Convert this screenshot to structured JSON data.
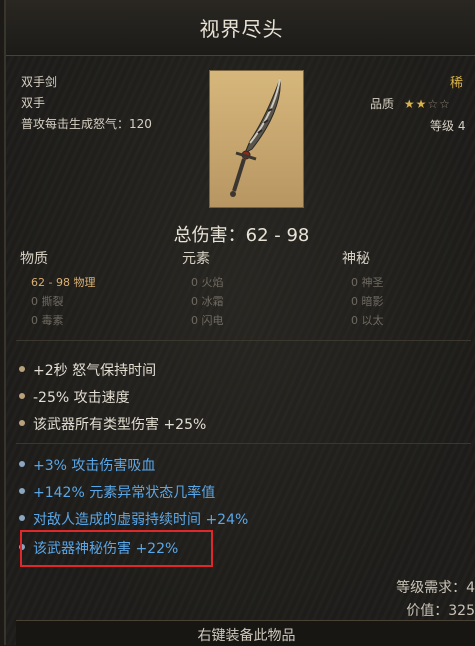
{
  "item": {
    "name": "视界尽头",
    "type": "双手剑",
    "handedness": "双手",
    "rage_gen": "普攻每击生成怒气：120",
    "rarity": "稀",
    "quality_label": "品质",
    "stars_filled": "★★",
    "stars_empty": "☆☆",
    "level_label": "等级 4",
    "total_damage": "总伤害：62 - 98"
  },
  "damage_columns": {
    "physical": "物质",
    "elemental": "元素",
    "mystic": "神秘"
  },
  "damage_rows": {
    "physical": [
      "62 - 98  物理",
      "0  撕裂",
      "0  毒素"
    ],
    "elemental": [
      "0  火焰",
      "0  冰霜",
      "0  闪电"
    ],
    "mystic": [
      "0  神圣",
      "0  暗影",
      "0  以太"
    ]
  },
  "base_mods": [
    "+2秒 怒气保持时间",
    "-25% 攻击速度",
    "该武器所有类型伤害 +25%"
  ],
  "magic_mods": [
    "+3% 攻击伤害吸血",
    "+142% 元素异常状态几率值",
    "对敌人造成的虚弱持续时间 +24%",
    "该武器神秘伤害 +22%"
  ],
  "requirements": {
    "level_req": "等级需求：4",
    "value": "价值：325"
  },
  "footer": "右键装备此物品",
  "colors": {
    "rarity_gold": "#d8b24a",
    "magic_blue": "#5aa7e8",
    "highlight_red": "#e0282a"
  }
}
